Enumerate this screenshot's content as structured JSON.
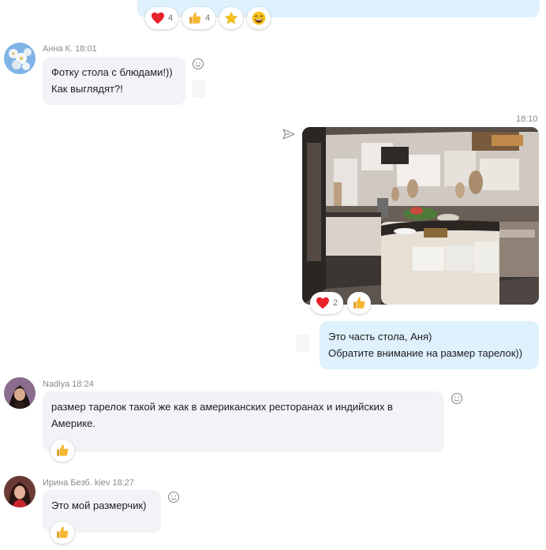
{
  "top_reactions": {
    "heart_count": "4",
    "like_count": "4"
  },
  "messages": {
    "anna": {
      "meta": "Анна К. 18:01",
      "line1": "Фотку стола с блюдами!))",
      "line2": "Как выглядят?!"
    },
    "own_photo": {
      "time": "18:10",
      "heart_count": "2"
    },
    "own_text": {
      "line1": "Это часть стола, Аня)",
      "line2": "Обратите внимание на размер тарелок))"
    },
    "nadiya": {
      "meta": "Nadiya 18:24",
      "line1": "размер тарелок такой же как в американских ресторанах и индийских в",
      "line2": "Америке."
    },
    "irina": {
      "meta": "Ирина Безб. kiev 18:27",
      "line1": "Это мой размерчик)"
    }
  },
  "colors": {
    "incoming_bubble": "#f1f3f6",
    "outgoing_bubble": "#def1fd",
    "heart": "#e8222b",
    "like": "#f5b731"
  }
}
